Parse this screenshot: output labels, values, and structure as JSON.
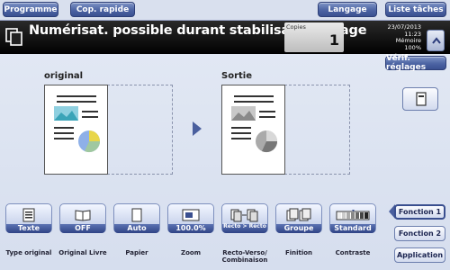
{
  "toolbar": {
    "programme": "Programme",
    "cop_rapide": "Cop. rapide",
    "langage": "Langage",
    "liste_taches": "Liste tâches"
  },
  "title": "Numérisat. possible durant stabilisation image",
  "copies": {
    "label": "Copies",
    "value": "1"
  },
  "status": {
    "date": "23/07/2013",
    "time": "11:23",
    "memoire_label": "Mémoire",
    "memoire_value": "100%"
  },
  "verif_button": "Vérif. réglages",
  "preview": {
    "original_label": "original",
    "sortie_label": "Sortie"
  },
  "functions": [
    {
      "value": "Texte",
      "label": "Type original"
    },
    {
      "value": "OFF",
      "label": "Original Livre"
    },
    {
      "value": "Auto",
      "label": "Papier"
    },
    {
      "value": "100.0%",
      "label": "Zoom"
    },
    {
      "value": "Recto > Recto",
      "label": "Recto-Verso/ Combinaison"
    },
    {
      "value": "Groupe",
      "label": "Finition"
    },
    {
      "value": "Standard",
      "label": "Contraste"
    }
  ],
  "side_menu": {
    "fonction1": "Fonction 1",
    "fonction2": "Fonction 2",
    "application": "Application"
  },
  "colors": {
    "accent": "#4c64a3",
    "title_bg": "#000000"
  }
}
